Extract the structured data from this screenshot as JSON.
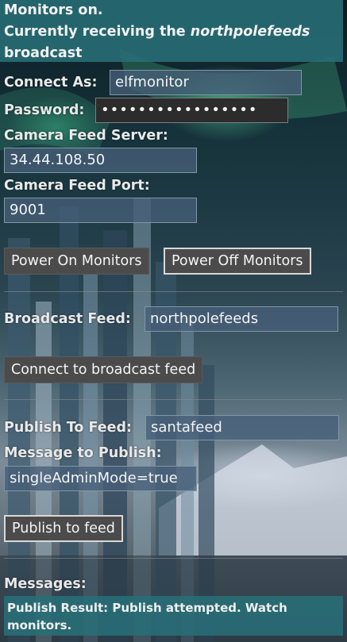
{
  "status": {
    "line1": "Monitors on.",
    "line2_prefix": "Currently receiving the ",
    "feed_name": "northpolefeeds",
    "line3": "broadcast"
  },
  "connect": {
    "connect_as_label": "Connect As:",
    "connect_as_value": "elfmonitor",
    "password_label": "Password:",
    "password_value": "•••••••••••••••••",
    "server_label": "Camera Feed Server:",
    "server_value": "34.44.108.50",
    "port_label": "Camera Feed Port:",
    "port_value": "9001"
  },
  "monitors": {
    "power_on_label": "Power On Monitors",
    "power_off_label": "Power Off Monitors"
  },
  "broadcast": {
    "feed_label": "Broadcast Feed:",
    "feed_value": "northpolefeeds",
    "connect_button": "Connect to broadcast feed"
  },
  "publish": {
    "feed_label": "Publish To Feed:",
    "feed_value": "santafeed",
    "message_label": "Message to Publish:",
    "message_value": "singleAdminMode=true",
    "publish_button": "Publish to feed"
  },
  "messages": {
    "heading": "Messages:",
    "result": "Publish Result: Publish attempted. Watch monitors."
  },
  "colors": {
    "banner": "#2a7a84",
    "field": "#465f78",
    "button": "#4b4b4b"
  }
}
